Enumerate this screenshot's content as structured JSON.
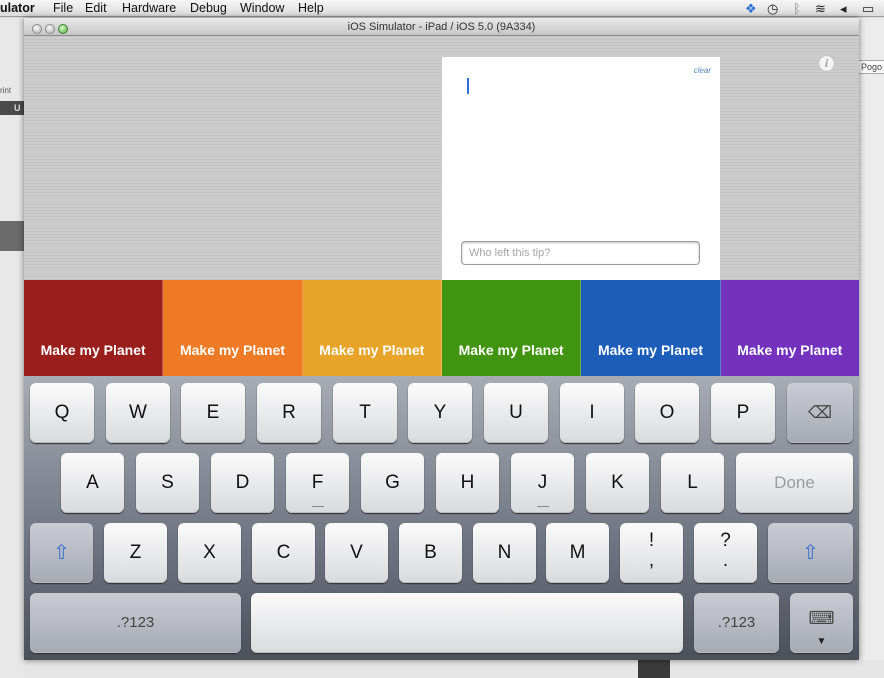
{
  "menubar": {
    "app": "ulator",
    "items": [
      "File",
      "Edit",
      "Hardware",
      "Debug",
      "Window",
      "Help"
    ]
  },
  "background": {
    "print_label": "rint",
    "dark_label": "U",
    "right_label": "Pogo"
  },
  "window": {
    "title": "iOS Simulator - iPad / iOS 5.0 (9A334)"
  },
  "tip_card": {
    "clear_label": "clear",
    "input_placeholder": "Who left this tip?",
    "input_value": ""
  },
  "info_icon": "i",
  "planets": [
    {
      "label": "Make my Planet",
      "color": "#9a1e1c"
    },
    {
      "label": "Make my Planet",
      "color": "#ee7a26"
    },
    {
      "label": "Make my Planet",
      "color": "#e8a428"
    },
    {
      "label": "Make my Planet",
      "color": "#41940f"
    },
    {
      "label": "Make my Planet",
      "color": "#1c5dba"
    },
    {
      "label": "Make my Planet",
      "color": "#7431bd"
    }
  ],
  "keyboard": {
    "row1": [
      "Q",
      "W",
      "E",
      "R",
      "T",
      "Y",
      "U",
      "I",
      "O",
      "P"
    ],
    "row2": [
      "A",
      "S",
      "D",
      "F",
      "G",
      "H",
      "J",
      "K",
      "L"
    ],
    "row3": [
      "Z",
      "X",
      "C",
      "V",
      "B",
      "N",
      "M"
    ],
    "punct1": {
      "top": "!",
      "bottom": ","
    },
    "punct2": {
      "top": "?",
      "bottom": "."
    },
    "done_label": "Done",
    "numbers_label": ".?123",
    "icons": {
      "backspace": "backspace-icon",
      "shift": "shift-icon",
      "hide_keyboard": "keyboard-hide-icon"
    }
  }
}
